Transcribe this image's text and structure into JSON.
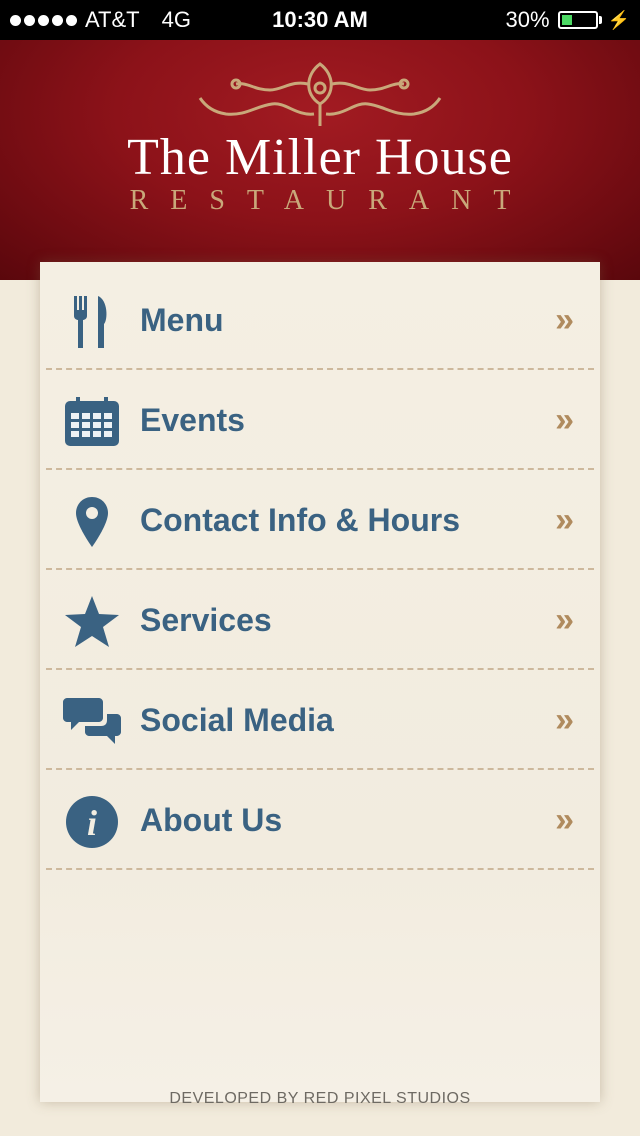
{
  "status_bar": {
    "carrier": "AT&T",
    "network": "4G",
    "time": "10:30 AM",
    "battery_percent": "30%",
    "battery_level": 0.3
  },
  "header": {
    "title": "The Miller House",
    "subtitle": "RESTAURANT"
  },
  "menu": {
    "items": [
      {
        "label": "Menu",
        "icon": "fork-knife-icon"
      },
      {
        "label": "Events",
        "icon": "calendar-icon"
      },
      {
        "label": "Contact Info & Hours",
        "icon": "map-pin-icon"
      },
      {
        "label": "Services",
        "icon": "star-icon"
      },
      {
        "label": "Social Media",
        "icon": "chat-bubbles-icon"
      },
      {
        "label": "About Us",
        "icon": "info-icon"
      }
    ],
    "chevron": "»"
  },
  "footer": {
    "credit": "DEVELOPED BY RED PIXEL STUDIOS"
  },
  "colors": {
    "header_red": "#8c1219",
    "label_blue": "#3a6282",
    "chevron_tan": "#b08b5e",
    "subtitle_gold": "#c9a87a"
  }
}
